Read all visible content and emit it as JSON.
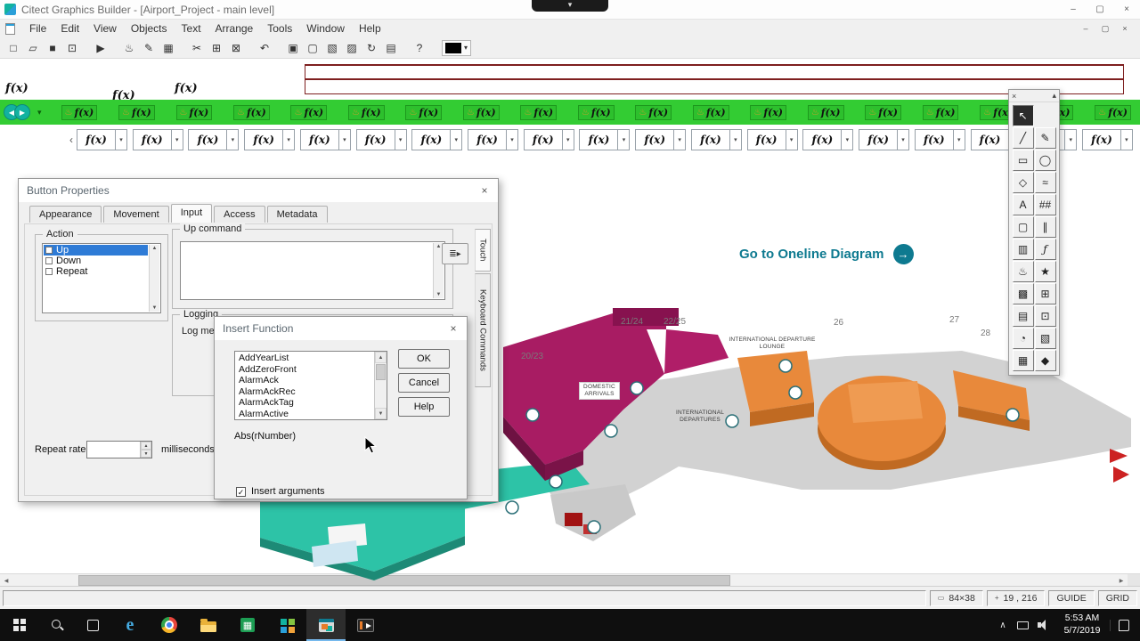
{
  "colors": {
    "band_green": "#33cc33",
    "magenta": "#a81c63",
    "magenta_dark": "#6e1242",
    "orange": "#e8893b",
    "orange_dark": "#c06a22",
    "teal": "#2dc3a7",
    "teal_dark": "#1d8a76",
    "link_teal": "#0e7a90",
    "selection_blue": "#2e7bd6",
    "map_gray": "#d2d2d2",
    "red_accent": "#cc2222"
  },
  "recorder": {
    "chevron": "▾"
  },
  "titlebar": {
    "title": "Citect Graphics Builder - [Airport_Project - main level]",
    "minimize": "–",
    "maximize": "▢",
    "close": "×"
  },
  "menu": {
    "items": [
      "File",
      "Edit",
      "View",
      "Objects",
      "Text",
      "Arrange",
      "Tools",
      "Window",
      "Help"
    ],
    "minimize": "–",
    "maximize": "▢",
    "close": "×"
  },
  "toolbar": {
    "buttons": [
      {
        "name": "new-button",
        "glyph": "□"
      },
      {
        "name": "open-button",
        "glyph": "▱"
      },
      {
        "name": "save-button",
        "glyph": "■"
      },
      {
        "name": "print-button",
        "glyph": "⊡"
      },
      {
        "name": "run-button",
        "glyph": "▶"
      },
      {
        "name": "genie-button",
        "glyph": "♨"
      },
      {
        "name": "edit-button",
        "glyph": "✎"
      },
      {
        "name": "grid-button",
        "glyph": "▦"
      },
      {
        "name": "cut-button",
        "glyph": "✂"
      },
      {
        "name": "copy-button",
        "glyph": "⊞"
      },
      {
        "name": "paste-button",
        "glyph": "⊠"
      },
      {
        "name": "undo-button",
        "glyph": "↶"
      },
      {
        "name": "group-button",
        "glyph": "▣"
      },
      {
        "name": "ungroup-button",
        "glyph": "▢"
      },
      {
        "name": "bring-to-front-button",
        "glyph": "▧"
      },
      {
        "name": "send-to-back-button",
        "glyph": "▨"
      },
      {
        "name": "rotate-button",
        "glyph": "↻"
      },
      {
        "name": "align-button",
        "glyph": "▤"
      },
      {
        "name": "help-button",
        "glyph": "?"
      }
    ],
    "dropdown_glyph": "▾",
    "fill_color": "#000000"
  },
  "function_bar": {
    "floating_labels": [
      "f(x)",
      "f(x)",
      "f(x)"
    ],
    "lamp_glyph": "♨",
    "back_glyph": "◀",
    "forward_glyph": "▶",
    "chevron_glyph": "▾",
    "left_scroll_glyph": "‹",
    "dropdown_glyph": "▾",
    "genie_items": [
      "f(x)",
      "f(x)",
      "f(x)",
      "f(x)",
      "f(x)",
      "f(x)",
      "f(x)",
      "f(x)",
      "f(x)",
      "f(x)",
      "f(x)",
      "f(x)",
      "f(x)",
      "f(x)",
      "f(x)",
      "f(x)",
      "f(x)",
      "f(x)",
      "f(x)"
    ],
    "symbol_items": [
      "f(x)",
      "f(x)",
      "f(x)",
      "f(x)",
      "f(x)",
      "f(x)",
      "f(x)",
      "f(x)",
      "f(x)",
      "f(x)",
      "f(x)",
      "f(x)",
      "f(x)",
      "f(x)",
      "f(x)",
      "f(x)",
      "f(x)",
      "f(x)",
      "f(x)"
    ]
  },
  "map": {
    "link_label": "Go to Oneline Diagram",
    "link_arrow_glyph": "→",
    "gates": [
      "20/23",
      "21/24",
      "22/25",
      "26",
      "27",
      "28"
    ],
    "areas": {
      "lounge": "INTERNATIONAL DEPARTURE LOUNGE",
      "domestic": "DOMESTIC ARRIVALS",
      "departures": "INTERNATIONAL DEPARTURES"
    }
  },
  "button_properties": {
    "title": "Button Properties",
    "close_glyph": "×",
    "tabs": [
      {
        "label": "Appearance"
      },
      {
        "label": "Movement"
      },
      {
        "label": "Input",
        "selected": true
      },
      {
        "label": "Access"
      },
      {
        "label": "Metadata"
      }
    ],
    "action_group": {
      "label": "Action",
      "items": [
        {
          "label": "Up",
          "selected": true
        },
        {
          "label": "Down"
        },
        {
          "label": "Repeat"
        }
      ]
    },
    "up_command_label": "Up command",
    "side_tabs": [
      {
        "label": "Touch",
        "selected": true
      },
      {
        "label": "Keyboard Commands"
      }
    ],
    "logging_label": "Logging",
    "log_message_label": "Log messa",
    "repeat_rate_label": "Repeat rate:",
    "repeat_rate_value": "",
    "repeat_rate_unit": "milliseconds"
  },
  "insert_function": {
    "title": "Insert Function",
    "close_glyph": "×",
    "functions": [
      "AddYearList",
      "AddZeroFront",
      "AlarmAck",
      "AlarmAckRec",
      "AlarmAckTag",
      "AlarmActive"
    ],
    "signature": "Abs(rNumber)",
    "ok_label": "OK",
    "cancel_label": "Cancel",
    "help_label": "Help",
    "insert_arguments_label": "Insert arguments",
    "insert_arguments_checked": true
  },
  "palette": {
    "close_glyph": "×",
    "collapse_glyph": "▴",
    "tools": [
      {
        "name": "select-tool",
        "glyph": "↖",
        "selected": true
      },
      {
        "name": "empty-cell",
        "glyph": ""
      },
      {
        "name": "line-tool",
        "glyph": "╱"
      },
      {
        "name": "pencil-tool",
        "glyph": "✎"
      },
      {
        "name": "rectangle-tool",
        "glyph": "▭"
      },
      {
        "name": "ellipse-tool",
        "glyph": "◯"
      },
      {
        "name": "polygon-tool",
        "glyph": "◇"
      },
      {
        "name": "freehand-line-tool",
        "glyph": "≈"
      },
      {
        "name": "text-tool",
        "glyph": "A"
      },
      {
        "name": "number-tool",
        "glyph": "##"
      },
      {
        "name": "button-tool",
        "glyph": "▢"
      },
      {
        "name": "pipe-tool",
        "glyph": "∥"
      },
      {
        "name": "symbol-set-tool",
        "glyph": "▥"
      },
      {
        "name": "function-tool",
        "glyph": "ƒ"
      },
      {
        "name": "genie-tool",
        "glyph": "♨"
      },
      {
        "name": "super-genie-tool",
        "glyph": "★"
      },
      {
        "name": "paste-symbol-tool",
        "glyph": "▩"
      },
      {
        "name": "paste-genie-tool",
        "glyph": "⊞"
      },
      {
        "name": "table-tool",
        "glyph": "▤"
      },
      {
        "name": "printer-tool",
        "glyph": "⊡"
      },
      {
        "name": "pie-chart-tool",
        "glyph": "◔"
      },
      {
        "name": "trend-chart-tool",
        "glyph": "▧"
      },
      {
        "name": "color-grid-tool",
        "glyph": "▦"
      },
      {
        "name": "ole-object-tool",
        "glyph": "◆"
      }
    ]
  },
  "glyphs": {
    "up": "▲",
    "down": "▼",
    "left": "◀",
    "right": "▶",
    "check": "✓"
  },
  "status_bar": {
    "size_icon": "▭",
    "size": "84×38",
    "position_icon": "+",
    "position": "19 , 216",
    "guide": "GUIDE",
    "grid": "GRID"
  },
  "taskbar": {
    "icons": [
      "start",
      "search",
      "task-view",
      "edge",
      "chrome",
      "file-explorer",
      "spreadsheet-app",
      "citect-project-app",
      "graphics-builder-app",
      "media-player-app"
    ],
    "tray_chevron": "∧",
    "time": "5:53 AM",
    "date": "5/7/2019"
  }
}
